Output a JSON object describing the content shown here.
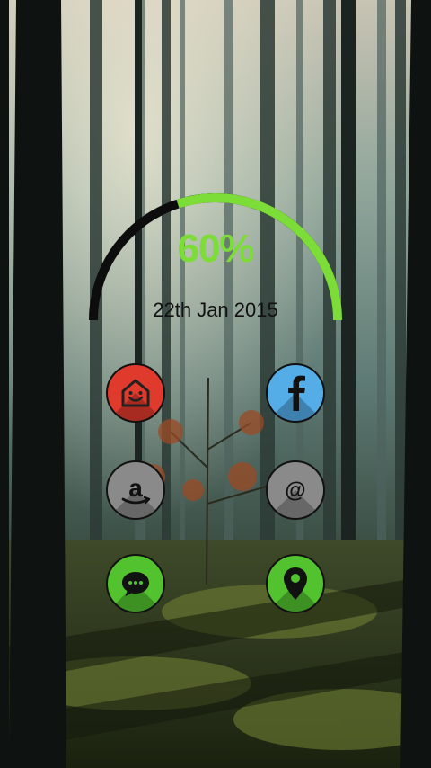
{
  "widget": {
    "percent_text": "60%",
    "progress": 0.6,
    "date_text": "22th Jan 2015",
    "colors": {
      "progress": "#7cdc38",
      "track": "#0d0d0d"
    }
  },
  "apps": [
    {
      "name": "home",
      "icon": "home-smile-icon",
      "color": "#e03a2c"
    },
    {
      "name": "facebook",
      "icon": "facebook-icon",
      "color": "#55ade8"
    },
    {
      "name": "amazon",
      "icon": "amazon-icon",
      "color": "#8a8a8a"
    },
    {
      "name": "email",
      "icon": "at-sign-icon",
      "color": "#8a8a8a"
    },
    {
      "name": "messages",
      "icon": "chat-bubble-icon",
      "color": "#52c22e"
    },
    {
      "name": "maps",
      "icon": "map-pin-icon",
      "color": "#52c22e"
    }
  ]
}
